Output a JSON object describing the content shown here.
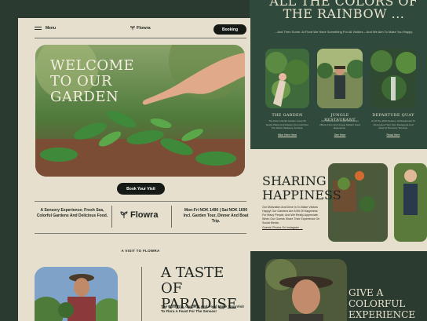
{
  "right_page": {
    "title": "ALL THE COLORS OF THE RAINBOW ...",
    "subtitle": "...And Then Some. At Flora We Have Something For All Visitors – And We Aim To Make You Happy.",
    "cards": [
      {
        "title": "THE GARDEN",
        "text": "The Most Colorful Garden Cover 50 Exotic Plants And Flowers From All Over The World. Welcome To Flora.",
        "link": "Hike Here Here"
      },
      {
        "title": "JUNGLE RESTAURANT",
        "text": "Our Greenhouse Jungle Restaurant Offers A Fun And Unique Modern Food Experience.",
        "link": "See Here"
      },
      {
        "title": "DEPARTURE QUAY",
        "text": "At Of The 2020 Season, All Departures To Flora Have Their Own Restaurant And Meet At The Ferry Terminal.",
        "link": "Read Here"
      }
    ],
    "sharing": {
      "title": "SHARING HAPPINESS",
      "text": "Our Motivation And Drive Is To Make Visitors Happy! Our Gardens Are A Bit Of Happiness For Many People, And We Really Appreciate When Our Guests Share Their Experience On Social Media.",
      "link": "Guests' Photos On Instagram →"
    },
    "colorful_title": "GIVE A COLORFUL EXPERIENCE"
  },
  "header": {
    "menu_label": "Menu",
    "logo_text": "Flowra",
    "booking_label": "Booking"
  },
  "hero": {
    "title": "WELCOME TO OUR GARDEN",
    "cta_label": "Book Your Visit"
  },
  "info": {
    "left": "A Sensory Experience; Fresh Sea, Colorful Gardens And Delicious Food.",
    "logo_text": "Flowra",
    "right": "Mon-Fri NOK 1490 | Sat NOK 1690 Incl. Garden Tour, Dinner And Boat Trip."
  },
  "visit": {
    "label": "A VISIT TO FLOWRA",
    "title": "A TASTE OF PARADISE",
    "text": "The Boat Trip, Gardens And Food Make Your Visit To Flora A Feast For The Senses!"
  },
  "colors": {
    "page_bg": "#e7dfcd",
    "dark_green": "#2f4a3c",
    "button": "#151a16",
    "text": "#1d241f"
  }
}
